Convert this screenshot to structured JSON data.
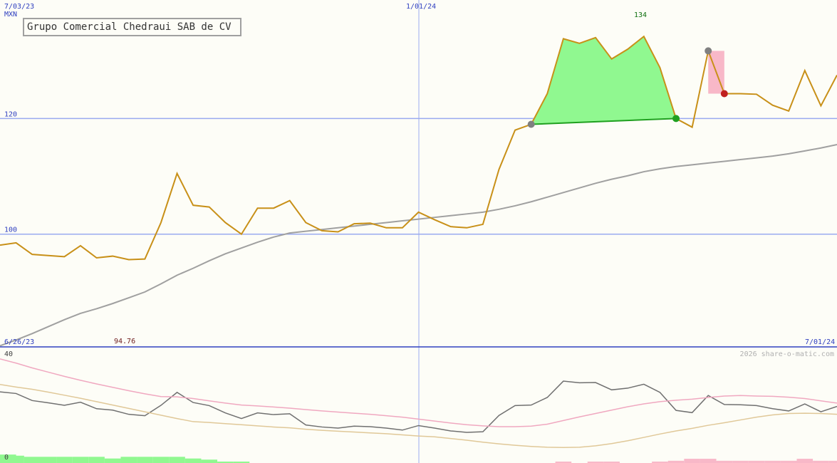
{
  "chart_data": [
    {
      "type": "line",
      "title": "Grupo Comercial Chedraui SAB de CV",
      "ylabel": "MXN",
      "date_labels": {
        "top_left": "7/03/23",
        "top_mid": "1/01/24",
        "bottom_left": "6/26/23",
        "bottom_right": "7/01/24"
      },
      "y_ticks": [
        100,
        120
      ],
      "ylim": [
        80.5,
        140.5
      ],
      "annotations": {
        "high": "134",
        "low": "94.76"
      },
      "series": [
        {
          "color": "#c89018",
          "values": [
            98.1,
            98.5,
            96.5,
            96.3,
            96.1,
            98.0,
            95.9,
            96.2,
            95.6,
            95.7,
            102.0,
            110.5,
            105.0,
            104.7,
            102.0,
            100.0,
            104.5,
            104.5,
            105.8,
            102.0,
            100.6,
            100.4,
            101.8,
            101.9,
            101.1,
            101.1,
            103.8,
            102.5,
            101.3,
            101.1,
            101.7,
            111.2,
            118.0,
            119.0,
            124.3,
            133.8,
            133.0,
            134.0,
            130.3,
            132.0,
            134.2,
            128.8,
            120.0,
            118.5,
            131.7,
            124.3,
            124.3,
            124.2,
            122.3,
            121.3,
            128.3,
            122.2,
            127.5
          ]
        },
        {
          "color": "#a0a0a0",
          "values": [
            80.7,
            81.7,
            82.8,
            84.0,
            85.2,
            86.3,
            87.1,
            88.0,
            89.0,
            90.0,
            91.4,
            92.9,
            94.1,
            95.4,
            96.6,
            97.6,
            98.6,
            99.5,
            100.2,
            100.5,
            100.8,
            101.1,
            101.4,
            101.7,
            102.0,
            102.3,
            102.6,
            102.9,
            103.2,
            103.5,
            103.8,
            104.3,
            104.9,
            105.6,
            106.4,
            107.2,
            108.0,
            108.8,
            109.5,
            110.1,
            110.8,
            111.3,
            111.7,
            112.0,
            112.3,
            112.6,
            112.9,
            113.2,
            113.5,
            113.9,
            114.4,
            114.9,
            115.5
          ]
        }
      ],
      "markers": [
        {
          "type": "gain",
          "from_index": 33,
          "to_index": 42,
          "from_value": 119.0,
          "to_value": 120.0
        },
        {
          "type": "loss",
          "from_index": 44,
          "to_index": 45,
          "from_value": 131.7,
          "to_value": 124.3
        }
      ]
    },
    {
      "type": "line",
      "y_ticks": [
        0,
        40
      ],
      "ylim": [
        0,
        40
      ],
      "series": [
        {
          "color": "#707070",
          "values": [
            25.3,
            24.7,
            22.2,
            21.4,
            20.5,
            21.6,
            19.3,
            18.8,
            17.3,
            16.8,
            20.5,
            25.1,
            21.5,
            20.4,
            17.8,
            15.8,
            17.8,
            17.2,
            17.5,
            13.5,
            12.8,
            12.4,
            13.1,
            12.9,
            12.4,
            11.7,
            13.3,
            12.4,
            11.4,
            10.9,
            11.1,
            16.9,
            20.4,
            20.6,
            23.3,
            29.1,
            28.5,
            28.6,
            26.0,
            26.6,
            28.0,
            25.1,
            18.7,
            17.9,
            24.0,
            20.8,
            20.7,
            20.4,
            19.3,
            18.5,
            21.0,
            18.2,
            20.1
          ]
        },
        {
          "color": "#f0a8c0",
          "values": [
            37.0,
            35.5,
            33.8,
            32.3,
            30.8,
            29.4,
            28.1,
            26.9,
            25.7,
            24.6,
            23.6,
            23.5,
            22.9,
            22.1,
            21.3,
            20.6,
            20.3,
            19.9,
            19.5,
            19.0,
            18.5,
            18.1,
            17.7,
            17.3,
            16.8,
            16.3,
            15.6,
            14.9,
            14.2,
            13.6,
            13.2,
            12.9,
            12.9,
            13.1,
            13.8,
            15.1,
            16.4,
            17.6,
            18.8,
            20.0,
            21.0,
            21.8,
            22.3,
            22.7,
            23.3,
            23.8,
            24.0,
            23.8,
            23.7,
            23.4,
            22.9,
            22.1,
            21.3
          ]
        },
        {
          "color": "#e0c898",
          "values": [
            27.9,
            27.0,
            26.2,
            25.2,
            24.1,
            23.0,
            21.8,
            20.6,
            19.4,
            18.2,
            17.0,
            15.8,
            14.7,
            14.4,
            14.0,
            13.6,
            13.2,
            12.8,
            12.5,
            12.0,
            11.6,
            11.3,
            11.0,
            10.7,
            10.4,
            10.0,
            9.6,
            9.3,
            8.7,
            8.1,
            7.4,
            6.8,
            6.3,
            5.9,
            5.6,
            5.5,
            5.6,
            6.1,
            6.9,
            7.9,
            9.1,
            10.3,
            11.4,
            12.3,
            13.4,
            14.3,
            15.3,
            16.3,
            17.1,
            17.6,
            17.7,
            17.6,
            17.3
          ]
        }
      ],
      "volume_bars": {
        "green": [
          3.0,
          2.6,
          2.2,
          2.2,
          2.2,
          2.2,
          2.2,
          1.6,
          2.2,
          2.2,
          2.2,
          2.2,
          1.6,
          1.2,
          0.5,
          0.5
        ],
        "pink": [
          {
            "index": 35,
            "value": 0.5
          },
          {
            "index": 37,
            "value": 0.5
          },
          {
            "index": 38,
            "value": 0.5
          },
          {
            "index": 41,
            "value": 0.5
          },
          {
            "index": 42,
            "value": 0.8
          },
          {
            "index": 43,
            "value": 1.5
          },
          {
            "index": 44,
            "value": 1.5
          },
          {
            "index": 45,
            "value": 0.8
          },
          {
            "index": 46,
            "value": 0.8
          },
          {
            "index": 47,
            "value": 0.8
          },
          {
            "index": 48,
            "value": 0.8
          },
          {
            "index": 49,
            "value": 0.8
          },
          {
            "index": 50,
            "value": 1.5
          },
          {
            "index": 51,
            "value": 0.8
          },
          {
            "index": 52,
            "value": 0.8
          }
        ]
      }
    }
  ],
  "watermark": "2026 share-o-matic.com",
  "colors": {
    "axis": "#3040c0",
    "grid": "#9aaaf0",
    "gain_fill": "#90f890",
    "loss_fill": "#f8b8c8",
    "gain_line": "#20a020",
    "high_label": "#107010",
    "low_label": "#702020"
  }
}
